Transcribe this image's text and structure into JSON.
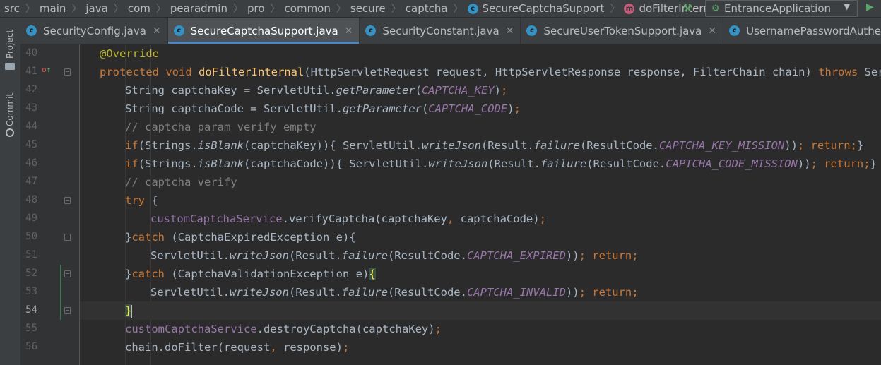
{
  "breadcrumb": {
    "items": [
      "src",
      "main",
      "java",
      "com",
      "pearadmin",
      "pro",
      "common",
      "secure",
      "captcha"
    ],
    "class_item": "SecureCaptchaSupport",
    "method_item": "doFilterInternal"
  },
  "toolbar": {
    "run_config_label": "EntranceApplication"
  },
  "toolstrip": {
    "project_label": "Project",
    "commit_label": "Commit"
  },
  "tabs": [
    {
      "label": "SecurityConfig.java",
      "active": false,
      "closable": true
    },
    {
      "label": "SecureCaptchaSupport.java",
      "active": true,
      "closable": true
    },
    {
      "label": "SecurityConstant.java",
      "active": false,
      "closable": true
    },
    {
      "label": "SecureUserTokenSupport.java",
      "active": false,
      "closable": true
    },
    {
      "label": "UsernamePasswordAuthentica",
      "active": false,
      "closable": false
    }
  ],
  "editor": {
    "current_line": 54,
    "lines": [
      {
        "num": "40"
      },
      {
        "num": "41"
      },
      {
        "num": "42"
      },
      {
        "num": "43"
      },
      {
        "num": "44"
      },
      {
        "num": "45"
      },
      {
        "num": "46"
      },
      {
        "num": "47"
      },
      {
        "num": "48"
      },
      {
        "num": "49"
      },
      {
        "num": "50"
      },
      {
        "num": "51"
      },
      {
        "num": "52"
      },
      {
        "num": "53"
      },
      {
        "num": "54"
      },
      {
        "num": "55"
      },
      {
        "num": "56"
      }
    ],
    "code": [
      [
        [
          "ann",
          "@Override"
        ]
      ],
      [
        [
          "kw",
          "protected void "
        ],
        [
          "fn",
          "doFilterInternal"
        ],
        [
          "",
          "(HttpServletRequest request, HttpServletResponse response, FilterChain chain) "
        ],
        [
          "kw",
          "throws "
        ],
        [
          "",
          "ServletE"
        ]
      ],
      [
        [
          "",
          "String captchaKey = ServletUtil."
        ],
        [
          "it",
          "getParameter"
        ],
        [
          "",
          "("
        ],
        [
          "st",
          "CAPTCHA_KEY"
        ],
        [
          "",
          ")"
        ],
        [
          "kw",
          ";"
        ]
      ],
      [
        [
          "",
          "String captchaCode = ServletUtil."
        ],
        [
          "it",
          "getParameter"
        ],
        [
          "",
          "("
        ],
        [
          "st",
          "CAPTCHA_CODE"
        ],
        [
          "",
          ")"
        ],
        [
          "kw",
          ";"
        ]
      ],
      [
        [
          "cm",
          "// captcha param verify empty"
        ]
      ],
      [
        [
          "kw",
          "if"
        ],
        [
          "",
          "(Strings."
        ],
        [
          "it",
          "isBlank"
        ],
        [
          "",
          "(captchaKey)){ ServletUtil."
        ],
        [
          "it",
          "writeJson"
        ],
        [
          "",
          "(Result."
        ],
        [
          "it",
          "failure"
        ],
        [
          "",
          "(ResultCode."
        ],
        [
          "st",
          "CAPTCHA_KEY_MISSION"
        ],
        [
          "",
          "))"
        ],
        [
          "kw",
          "; return;"
        ],
        [
          "",
          "}"
        ]
      ],
      [
        [
          "kw",
          "if"
        ],
        [
          "",
          "(Strings."
        ],
        [
          "it",
          "isBlank"
        ],
        [
          "",
          "(captchaCode)){ ServletUtil."
        ],
        [
          "it",
          "writeJson"
        ],
        [
          "",
          "(Result."
        ],
        [
          "it",
          "failure"
        ],
        [
          "",
          "(ResultCode."
        ],
        [
          "st",
          "CAPTCHA_CODE_MISSION"
        ],
        [
          "",
          "))"
        ],
        [
          "kw",
          "; return;"
        ],
        [
          "",
          "}"
        ]
      ],
      [
        [
          "cm",
          "// captcha verify"
        ]
      ],
      [
        [
          "kw",
          "try "
        ],
        [
          "",
          "{"
        ]
      ],
      [
        [
          "fld",
          "customCaptchaService"
        ],
        [
          "",
          ".verifyCaptcha(captchaKey"
        ],
        [
          "kw",
          ", "
        ],
        [
          "",
          "captchaCode)"
        ],
        [
          "kw",
          ";"
        ]
      ],
      [
        [
          "",
          "}"
        ],
        [
          "kw",
          "catch "
        ],
        [
          "",
          "(CaptchaExpiredException e){"
        ]
      ],
      [
        [
          "",
          "ServletUtil."
        ],
        [
          "it",
          "writeJson"
        ],
        [
          "",
          "(Result."
        ],
        [
          "it",
          "failure"
        ],
        [
          "",
          "(ResultCode."
        ],
        [
          "st",
          "CAPTCHA_EXPIRED"
        ],
        [
          "",
          "))"
        ],
        [
          "kw",
          "; return;"
        ]
      ],
      [
        [
          "",
          "}"
        ],
        [
          "kw",
          "catch "
        ],
        [
          "",
          "(CaptchaValidationException e)"
        ],
        [
          "bh",
          "{"
        ]
      ],
      [
        [
          "",
          "ServletUtil."
        ],
        [
          "it",
          "writeJson"
        ],
        [
          "",
          "(Result."
        ],
        [
          "it",
          "failure"
        ],
        [
          "",
          "(ResultCode."
        ],
        [
          "st",
          "CAPTCHA_INVALID"
        ],
        [
          "",
          "))"
        ],
        [
          "kw",
          "; return;"
        ]
      ],
      [
        [
          "bh",
          "}"
        ]
      ],
      [
        [
          "fld",
          "customCaptchaService"
        ],
        [
          "",
          ".destroyCaptcha(captchaKey)"
        ],
        [
          "kw",
          ";"
        ]
      ],
      [
        [
          "",
          "chain.doFilter(request"
        ],
        [
          "kw",
          ", "
        ],
        [
          "",
          "response)"
        ],
        [
          "kw",
          ";"
        ]
      ]
    ],
    "indent": [
      1,
      1,
      2,
      2,
      2,
      2,
      2,
      2,
      2,
      3,
      2,
      3,
      2,
      3,
      2,
      2,
      2
    ]
  },
  "icons": {
    "class_icon": "class-c-icon",
    "method_icon": "method-m-icon",
    "build_icon": "hammer-icon",
    "run_config_icon": "spring-boot-icon",
    "run_icon": "play-icon",
    "project_icon": "folder-icon",
    "commit_icon": "commit-icon"
  },
  "colors": {
    "keyword": "#cc7832",
    "annotation": "#bbb529",
    "method_decl": "#ffc66d",
    "static_field": "#9876aa",
    "comment": "#808080",
    "tab_underline": "#4a88c7"
  }
}
